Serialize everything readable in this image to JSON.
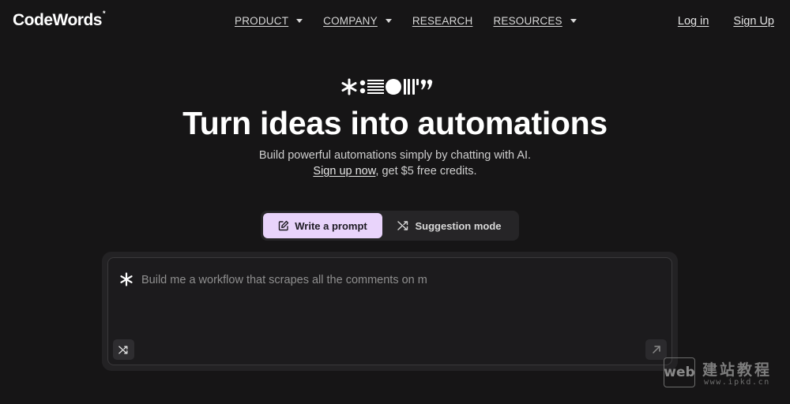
{
  "brand": {
    "name": "CodeWords",
    "mark": "*"
  },
  "nav": {
    "items": [
      {
        "label": "PRODUCT",
        "has_dropdown": true
      },
      {
        "label": "COMPANY",
        "has_dropdown": true
      },
      {
        "label": "RESEARCH",
        "has_dropdown": false
      },
      {
        "label": "RESOURCES",
        "has_dropdown": true
      }
    ],
    "login": "Log in",
    "signup": "Sign Up"
  },
  "hero": {
    "headline": "Turn ideas into automations",
    "subline": "Build powerful automations simply by chatting with AI.",
    "cta_link": "Sign up now",
    "cta_rest": ", get $5 free credits."
  },
  "mode_toggle": {
    "active": "Write a prompt",
    "inactive": "Suggestion mode",
    "active_color": "#e9d4fb"
  },
  "prompt": {
    "placeholder": "Build me a workflow that scrapes all the comments on m"
  },
  "icons": {
    "glyph_row": "decorative-glyph-row",
    "edit": "pencil-square-icon",
    "shuffle": "shuffle-icon",
    "send": "arrow-up-right-icon",
    "star": "asterisk-icon"
  },
  "watermark": {
    "box": "web",
    "title": "建站教程",
    "url": "www.ipkd.cn"
  }
}
